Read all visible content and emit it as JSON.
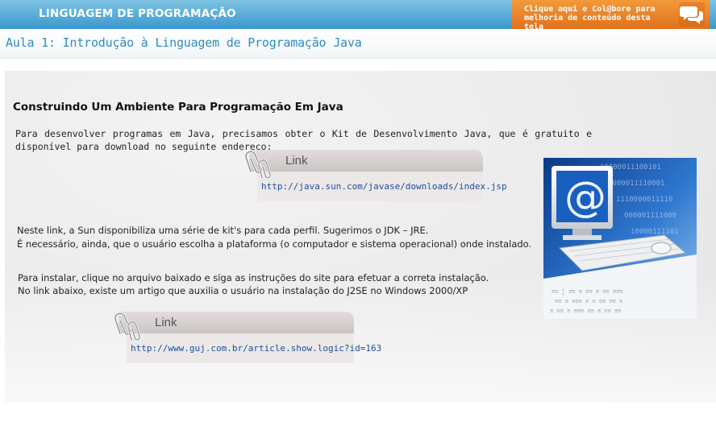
{
  "header": {
    "brand": "LINGUAGEM DE PROGRAMAÇÃO",
    "collab_line1": "Clique aqui e Col@bore para",
    "collab_line2": "melhoria de conteúdo desta tela",
    "collab_icon": "chat-bubbles-icon"
  },
  "lesson_title": "Aula 1: Introdução à Linguagem de Programação Java",
  "content": {
    "section_title": "Construindo Um Ambiente Para Programação Em Java",
    "intro": "Para desenvolver programas em Java, precisamos obter o Kit de Desenvolvimento Java, que é gratuito e disponível para download no seguinte endereço:",
    "link1": {
      "label": "Link",
      "url": "http://java.sun.com/javase/downloads/index.jsp",
      "icon": "paperclip-icon"
    },
    "para2_line1": "Neste link, a Sun disponibiliza uma série de kit's para cada perfil. Sugerimos o JDK – JRE.",
    "para2_line2": "É necessário, ainda, que o usuário escolha a plataforma (o computador e sistema operacional) onde instalado.",
    "para3_line1": "Para instalar, clique no arquivo baixado e siga as instruções do site para efetuar a correta instalação.",
    "para3_line2": "No link abaixo, existe um artigo que auxilia o usuário na instalação do J2SE no Windows 2000/XP",
    "link2": {
      "label": "Link",
      "url": "http://www.guj.com.br/article.show.logic?id=163",
      "icon": "paperclip-icon"
    },
    "image": "computer-with-at-sign-illustration"
  },
  "colors": {
    "header_blue": "#3a98cb",
    "collab_orange": "#e0711a",
    "title_blue": "#2f8dc2",
    "link_blue": "#1e4d9c"
  }
}
